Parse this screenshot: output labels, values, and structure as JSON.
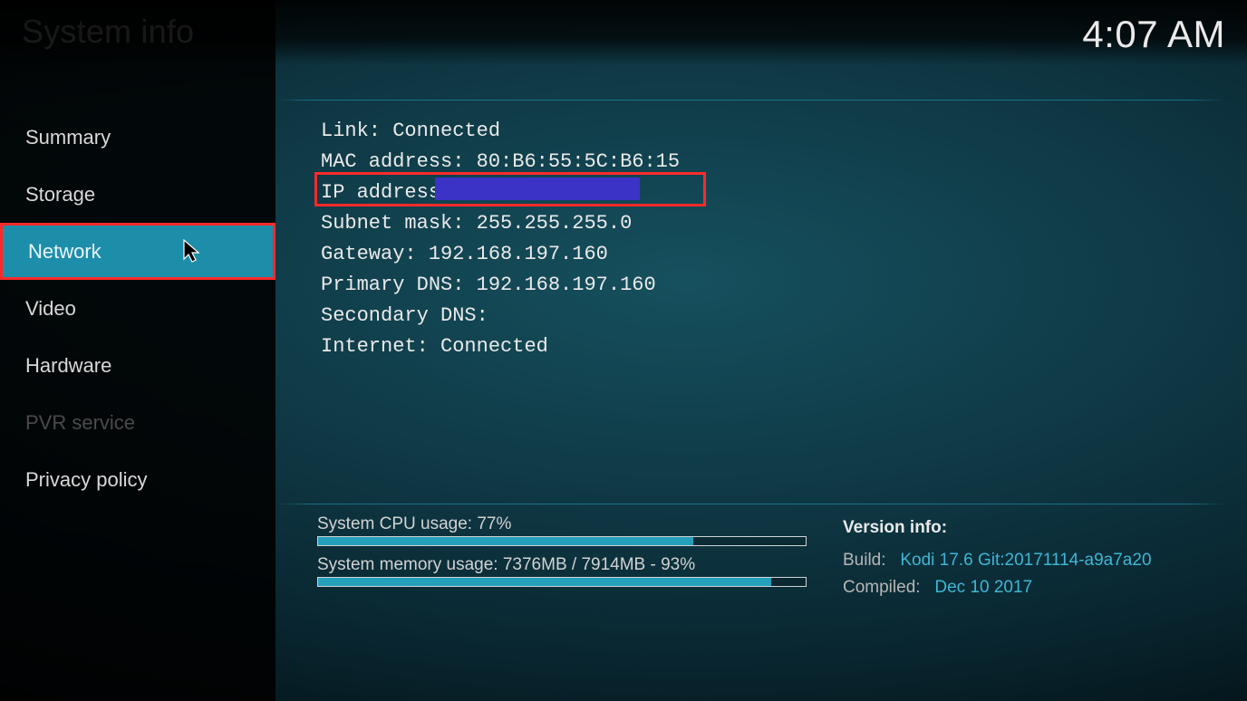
{
  "header": {
    "title": "System info",
    "clock": "4:07 AM"
  },
  "sidebar": {
    "items": [
      {
        "label": "Summary",
        "selected": false,
        "disabled": false
      },
      {
        "label": "Storage",
        "selected": false,
        "disabled": false
      },
      {
        "label": "Network",
        "selected": true,
        "disabled": false
      },
      {
        "label": "Video",
        "selected": false,
        "disabled": false
      },
      {
        "label": "Hardware",
        "selected": false,
        "disabled": false
      },
      {
        "label": "PVR service",
        "selected": false,
        "disabled": true
      },
      {
        "label": "Privacy policy",
        "selected": false,
        "disabled": false
      }
    ]
  },
  "network": {
    "link_label": "Link: ",
    "link_value": "Connected",
    "mac_label": "MAC address: ",
    "mac_value": "80:B6:55:5C:B6:15",
    "ip_label": "IP address: ",
    "ip_value": "",
    "subnet_label": "Subnet mask: ",
    "subnet_value": "255.255.255.0",
    "gateway_label": "Gateway: ",
    "gateway_value": "192.168.197.160",
    "pdns_label": "Primary DNS: ",
    "pdns_value": "192.168.197.160",
    "sdns_label": "Secondary DNS:",
    "sdns_value": "",
    "inet_label": "Internet: ",
    "inet_value": "Connected"
  },
  "footer": {
    "cpu_label": "System CPU usage: 77%",
    "cpu_pct": 77,
    "mem_label": "System memory usage: 7376MB / 7914MB - 93%",
    "mem_pct": 93,
    "version_heading": "Version info:",
    "build_label": "Build:",
    "build_value": "Kodi 17.6 Git:20171114-a9a7a20",
    "compiled_label": "Compiled:",
    "compiled_value": "Dec 10 2017"
  }
}
